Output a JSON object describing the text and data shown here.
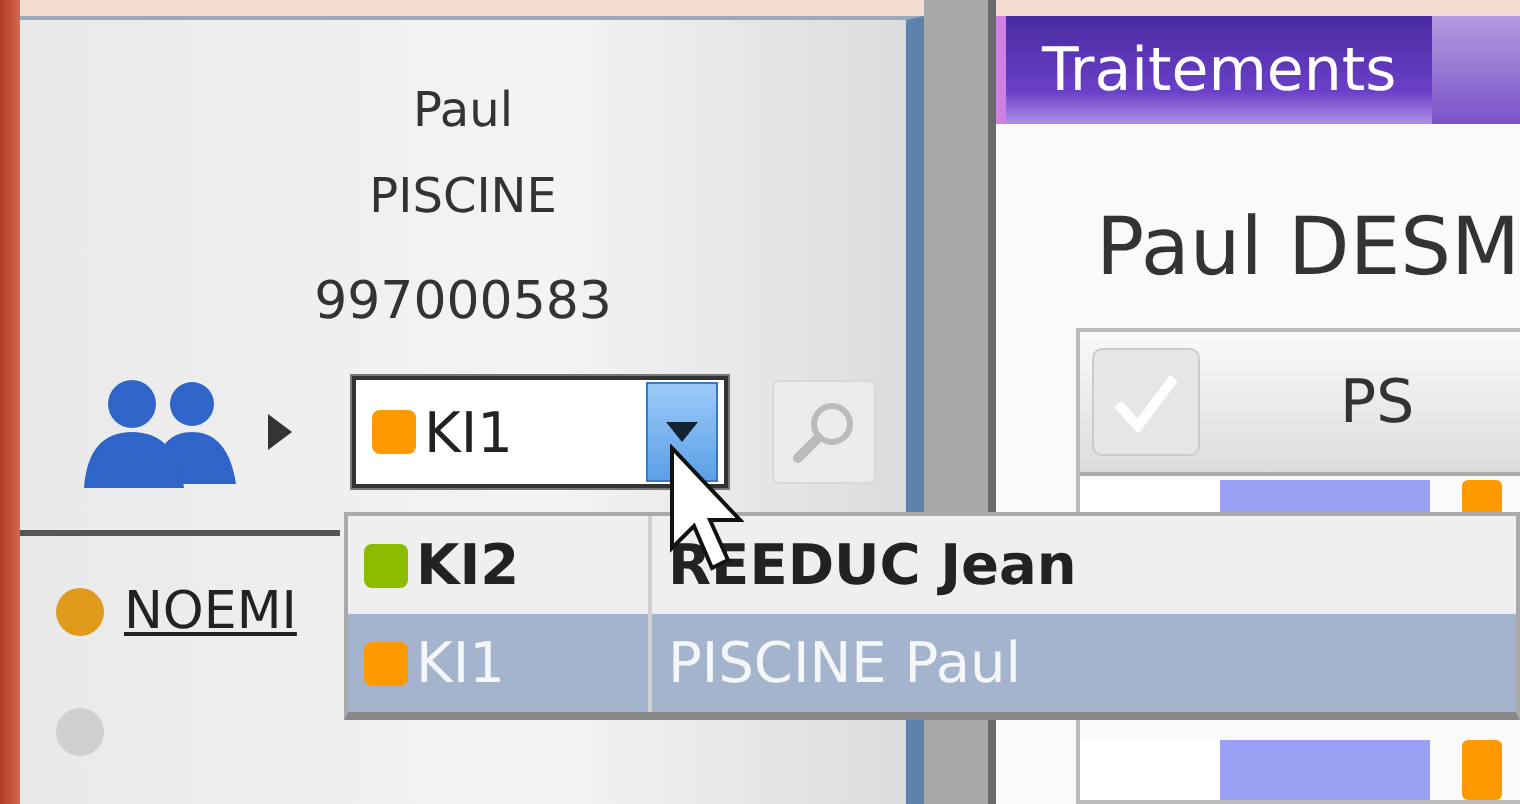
{
  "patient": {
    "first_name": "Paul",
    "last_name": "PISCINE",
    "id": "997000583"
  },
  "therapist_combo": {
    "code": "KI1",
    "color": "#ff9900",
    "expanded": true
  },
  "list": [
    {
      "label": "NOEMI",
      "color": "#e09a1c"
    },
    {
      "color": "#d0d0d0"
    }
  ],
  "tabs": [
    {
      "label": "Traitements",
      "selected": true
    }
  ],
  "title": "Paul DESM",
  "table": {
    "select_all_checked": true,
    "columns": [
      "PS"
    ]
  },
  "dropdown": [
    {
      "code": "KI2",
      "name": "REEDUC Jean",
      "color": "#8cbb00",
      "selected": false
    },
    {
      "code": "KI1",
      "name": "PISCINE Paul",
      "color": "#ff9900",
      "selected": true
    }
  ]
}
